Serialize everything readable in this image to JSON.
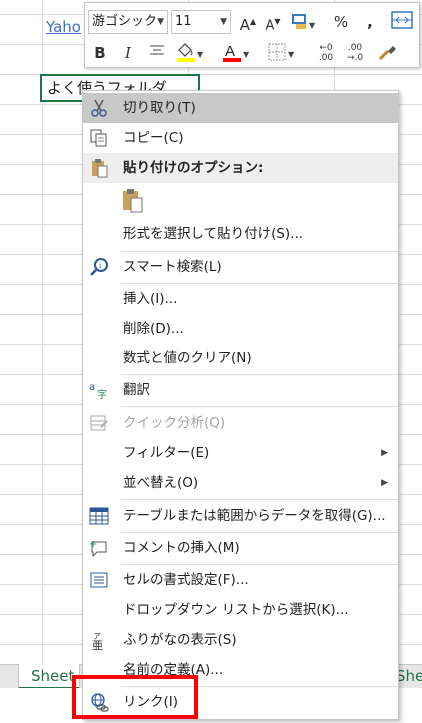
{
  "sheet": {
    "link_text": "Yaho",
    "active_cell_text": "よく使うフォルダ",
    "tab_left": "Sheet",
    "tab_right": "She",
    "accent_color": "#217346"
  },
  "mini_toolbar": {
    "font_name": "游ゴシック",
    "font_size": "11",
    "grow_font": "A",
    "shrink_font": "A",
    "percent": "%",
    "comma": ",",
    "bold": "B",
    "italic": "I",
    "font_color_label": "A",
    "fill_color": "#ffff00",
    "font_color": "#ff0000",
    "inc_decimal_top": "←0",
    "inc_decimal_bottom": ".00",
    "dec_decimal_top": ".00",
    "dec_decimal_bottom": "→.0"
  },
  "context_menu": {
    "items": [
      {
        "label": "切り取り(T)",
        "icon": "scissors-icon"
      },
      {
        "label": "コピー(C)",
        "icon": "copy-icon"
      },
      {
        "label": "貼り付けのオプション:",
        "icon": "paste-icon"
      },
      {
        "label": "形式を選択して貼り付け(S)...",
        "icon": ""
      },
      {
        "label": "スマート検索(L)",
        "icon": "smart-lookup-icon"
      },
      {
        "label": "挿入(I)...",
        "icon": ""
      },
      {
        "label": "削除(D)...",
        "icon": ""
      },
      {
        "label": "数式と値のクリア(N)",
        "icon": ""
      },
      {
        "label": "翻訳",
        "icon": "translate-icon"
      },
      {
        "label": "クイック分析(Q)",
        "icon": "quick-analysis-icon"
      },
      {
        "label": "フィルター(E)",
        "icon": ""
      },
      {
        "label": "並べ替え(O)",
        "icon": ""
      },
      {
        "label": "テーブルまたは範囲からデータを取得(G)...",
        "icon": "table-icon"
      },
      {
        "label": "コメントの挿入(M)",
        "icon": "comment-icon"
      },
      {
        "label": "セルの書式設定(F)...",
        "icon": "format-cells-icon"
      },
      {
        "label": "ドロップダウン リストから選択(K)...",
        "icon": ""
      },
      {
        "label": "ふりがなの表示(S)",
        "icon": "furigana-icon"
      },
      {
        "label": "名前の定義(A)...",
        "icon": ""
      },
      {
        "label": "リンク(I)",
        "icon": "link-icon"
      }
    ],
    "submenu_arrow": "▶",
    "highlight_color": "#ff0000"
  }
}
